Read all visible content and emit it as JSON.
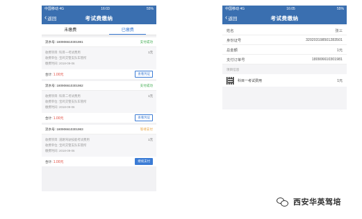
{
  "left": {
    "status": {
      "carrier": "中国移动",
      "network": "4G",
      "time": "16:03",
      "battery": "55%"
    },
    "nav": {
      "back_label": "返回",
      "title": "考试费缴纳"
    },
    "tabs": [
      {
        "label": "未缴费",
        "active": false
      },
      {
        "label": "已缴费",
        "active": true
      }
    ],
    "cards": [
      {
        "serial_label": "流水号:",
        "serial": "180906610301981",
        "status": "支付成功",
        "status_kind": "ok",
        "item_label": "收费项目:",
        "item": "科目一考试费用",
        "unit_label": "收费单位:",
        "unit": "宝鸡交警支队车管所",
        "time_label": "缴费时间:",
        "time": "2018-09-06",
        "amount": "1元",
        "total_label": "合计:",
        "total": "1.00元",
        "action": "查看凭证",
        "action_kind": "outline"
      },
      {
        "serial_label": "流水号:",
        "serial": "180906610301982",
        "status": "支付成功",
        "status_kind": "ok",
        "item_label": "收费项目:",
        "item": "科目二考试费用",
        "unit_label": "收费单位:",
        "unit": "宝鸡交警支队车管所",
        "time_label": "缴费时间:",
        "time": "2018-09-06",
        "amount": "1元",
        "total_label": "合计:",
        "total": "1.00元",
        "action": "查看凭证",
        "action_kind": "outline"
      },
      {
        "serial_label": "流水号:",
        "serial": "180906610301983",
        "status": "等待支付",
        "status_kind": "pending",
        "item_label": "收费项目:",
        "item": "道路驾驶技能考试费用",
        "unit_label": "收费单位:",
        "unit": "宝鸡交警支队车管所",
        "time_label": "缴费时间:",
        "time": "2018-09-06",
        "amount": "1元",
        "total_label": "合计:",
        "total": "1.00元",
        "action": "继续支付",
        "action_kind": "solid"
      }
    ]
  },
  "right": {
    "status": {
      "carrier": "中国移动",
      "network": "4G",
      "time": "16:05",
      "battery": "55%"
    },
    "nav": {
      "back_label": "返回",
      "title": "考试费缴纳"
    },
    "info_rows": [
      {
        "label": "姓名",
        "value": "张三"
      },
      {
        "label": "身份证号",
        "value": "320203198501283501"
      },
      {
        "label": "总金额",
        "value": "1元"
      },
      {
        "label": "支付订单号",
        "value": "180906610301981"
      }
    ],
    "section_label": "项目信息",
    "item": {
      "name": "科目一考试费用",
      "amount": "1元"
    }
  },
  "watermark": {
    "text": "西安华英驾培"
  },
  "colors": {
    "nav_blue": "#3a6fb0",
    "accent": "#3a7bd5",
    "success": "#3aa94a",
    "pending": "#e8a13a",
    "money": "#e0463a"
  }
}
